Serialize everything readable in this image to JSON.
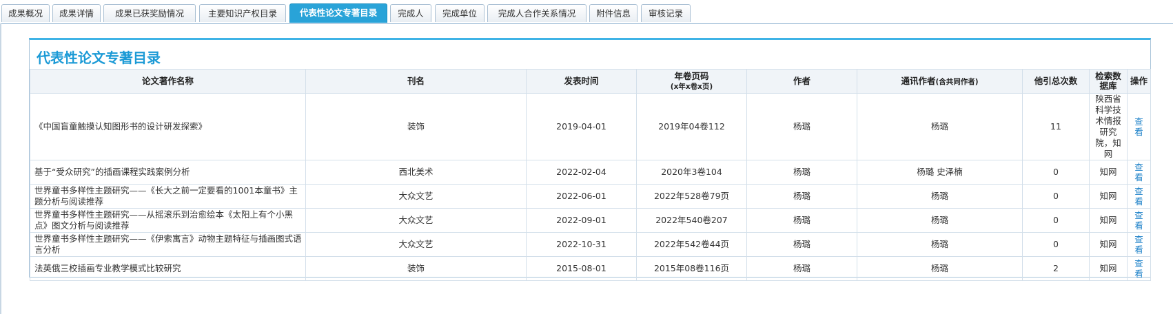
{
  "tabs": [
    {
      "label": "成果概况"
    },
    {
      "label": "成果详情"
    },
    {
      "label": "成果已获奖励情况"
    },
    {
      "label": "主要知识产权目录"
    },
    {
      "label": "代表性论文专著目录"
    },
    {
      "label": "完成人"
    },
    {
      "label": "完成单位"
    },
    {
      "label": "完成人合作关系情况"
    },
    {
      "label": "附件信息"
    },
    {
      "label": "审核记录"
    }
  ],
  "panel": {
    "title": "代表性论文专著目录"
  },
  "table": {
    "headers": {
      "name": "论文著作名称",
      "journal": "刊名",
      "date": "发表时间",
      "volume": "年卷页码",
      "volume_sub": "(x年x卷x页)",
      "author": "作者",
      "corr": "通讯作者",
      "corr_sub": "(含共同作者)",
      "cited": "他引总次数",
      "db": "检索数据库",
      "op": "操作"
    },
    "rows": [
      {
        "name": "《中国盲童触摸认知图形书的设计研发探索》",
        "journal": "装饰",
        "date": "2019-04-01",
        "volume": "2019年04卷112",
        "author": "杨璐",
        "corr": "杨璐",
        "cited": "11",
        "db": "陕西省科学技术情报研究院，知网",
        "op": "查看"
      },
      {
        "name": "基于“受众研究”的插画课程实践案例分析",
        "journal": "西北美术",
        "date": "2022-02-04",
        "volume": "2020年3卷104",
        "author": "杨璐",
        "corr": "杨璐 史泽楠",
        "cited": "0",
        "db": "知网",
        "op": "查看"
      },
      {
        "name": "世界童书多样性主题研究——《长大之前一定要看的1001本童书》主题分析与阅读推荐",
        "journal": "大众文艺",
        "date": "2022-06-01",
        "volume": "2022年528卷79页",
        "author": "杨璐",
        "corr": "杨璐",
        "cited": "0",
        "db": "知网",
        "op": "查看"
      },
      {
        "name": "世界童书多样性主题研究——从摇滚乐到治愈绘本《太阳上有个小黑点》图文分析与阅读推荐",
        "journal": "大众文艺",
        "date": "2022-09-01",
        "volume": "2022年540卷207",
        "author": "杨璐",
        "corr": "杨璐",
        "cited": "0",
        "db": "知网",
        "op": "查看"
      },
      {
        "name": "世界童书多样性主题研究——《伊索寓言》动物主题特征与插画图式语言分析",
        "journal": "大众文艺",
        "date": "2022-10-31",
        "volume": "2022年542卷44页",
        "author": "杨璐",
        "corr": "杨璐",
        "cited": "0",
        "db": "知网",
        "op": "查看"
      },
      {
        "name": "法英俄三校插画专业教学模式比较研究",
        "journal": "装饰",
        "date": "2015-08-01",
        "volume": "2015年08卷116页",
        "author": "杨璐",
        "corr": "杨璐",
        "cited": "2",
        "db": "知网",
        "op": "查看"
      }
    ]
  }
}
